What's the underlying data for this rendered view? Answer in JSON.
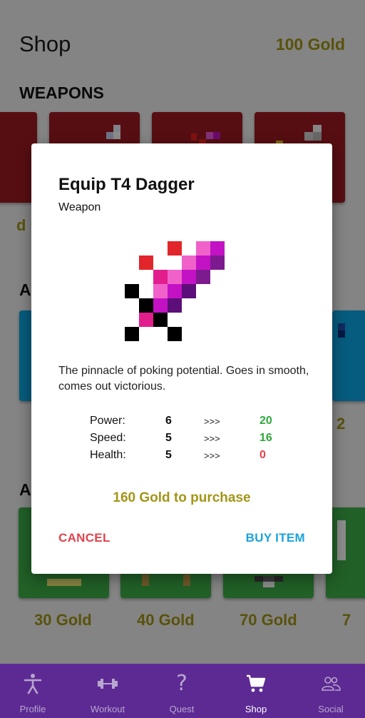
{
  "header": {
    "title": "Shop",
    "gold": "100 Gold"
  },
  "sections": {
    "weapons": "WEAPONS",
    "second_letter": "A",
    "third_letter": "A"
  },
  "background_prices": {
    "weapons_left_fragment": "d",
    "armor_right_fragment": "2",
    "bottom_row": [
      "30 Gold",
      "40 Gold",
      "70 Gold",
      "7"
    ]
  },
  "dialog": {
    "title": "Equip T4 Dagger",
    "subtitle": "Weapon",
    "description": "The pinnacle of poking potential. Goes in smooth, comes out victorious.",
    "stats": [
      {
        "label": "Power:",
        "current": "6",
        "arrow": ">>>",
        "new": "20",
        "new_color": "#2eaa3c"
      },
      {
        "label": "Speed:",
        "current": "5",
        "arrow": ">>>",
        "new": "16",
        "new_color": "#2eaa3c"
      },
      {
        "label": "Health:",
        "current": "5",
        "arrow": ">>>",
        "new": "0",
        "new_color": "#e2434d"
      }
    ],
    "cost": "160 Gold to purchase",
    "cancel_label": "CANCEL",
    "buy_label": "BUY ITEM"
  },
  "nav": {
    "items": [
      {
        "label": "Profile",
        "icon": "person-icon"
      },
      {
        "label": "Workout",
        "icon": "dumbbell-icon"
      },
      {
        "label": "Quest",
        "icon": "question-icon"
      },
      {
        "label": "Shop",
        "icon": "cart-icon",
        "active": true
      },
      {
        "label": "Social",
        "icon": "people-icon"
      }
    ]
  },
  "colors": {
    "gold_text": "#a39517",
    "nav_bg": "#5d2a93",
    "card_red": "#9e1b22",
    "card_blue": "#0ba8e6",
    "card_green": "#3caf47",
    "cancel": "#e2434d",
    "buy": "#1aa3dd"
  }
}
